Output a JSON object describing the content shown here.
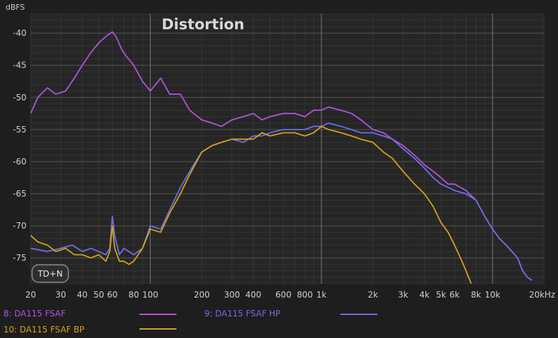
{
  "chart_data": {
    "type": "line",
    "title": "Distortion",
    "ylabel": "dBFS",
    "xunit": "Hz",
    "xscale": "log",
    "xlim": [
      20,
      20000
    ],
    "ylim": [
      -79,
      -37
    ],
    "grid": true,
    "legend_position": "bottom",
    "xticks": [
      {
        "v": 20,
        "label": "20"
      },
      {
        "v": 30,
        "label": "30"
      },
      {
        "v": 40,
        "label": "40"
      },
      {
        "v": 50,
        "label": "50"
      },
      {
        "v": 60,
        "label": "60"
      },
      {
        "v": 80,
        "label": "80"
      },
      {
        "v": 100,
        "label": "100"
      },
      {
        "v": 200,
        "label": "200"
      },
      {
        "v": 300,
        "label": "300"
      },
      {
        "v": 400,
        "label": "400"
      },
      {
        "v": 600,
        "label": "600"
      },
      {
        "v": 800,
        "label": "800"
      },
      {
        "v": 1000,
        "label": "1k"
      },
      {
        "v": 2000,
        "label": "2k"
      },
      {
        "v": 3000,
        "label": "3k"
      },
      {
        "v": 4000,
        "label": "4k"
      },
      {
        "v": 5000,
        "label": "5k"
      },
      {
        "v": 6000,
        "label": "6k"
      },
      {
        "v": 8000,
        "label": "8k"
      },
      {
        "v": 10000,
        "label": "10k"
      },
      {
        "v": 20000,
        "label": "20kHz"
      }
    ],
    "yticks": [
      {
        "v": -40,
        "label": "-40"
      },
      {
        "v": -45,
        "label": "-45"
      },
      {
        "v": -50,
        "label": "-50"
      },
      {
        "v": -55,
        "label": "-55"
      },
      {
        "v": -60,
        "label": "-60"
      },
      {
        "v": -65,
        "label": "-65"
      },
      {
        "v": -70,
        "label": "-70"
      },
      {
        "v": -75,
        "label": "-75"
      }
    ],
    "series": [
      {
        "name": "8: DA115 FSAF",
        "color": "#b254e0",
        "x": [
          20,
          22,
          25,
          28,
          32,
          36,
          40,
          45,
          50,
          55,
          60,
          63,
          68,
          72,
          80,
          90,
          100,
          115,
          130,
          150,
          170,
          200,
          230,
          260,
          300,
          350,
          400,
          450,
          500,
          600,
          700,
          800,
          900,
          1000,
          1100,
          1300,
          1500,
          1700,
          2000,
          2300,
          2600,
          3000,
          3500,
          4000,
          4500,
          5000,
          5500,
          6000,
          7000,
          8000,
          9000,
          10000,
          11000,
          12000,
          13000,
          14000,
          15000,
          16000,
          17000
        ],
        "y": [
          -52.5,
          -50,
          -48.5,
          -49.5,
          -49,
          -47,
          -45,
          -43,
          -41.5,
          -40.5,
          -39.8,
          -40.5,
          -42.5,
          -43.5,
          -45,
          -47.5,
          -49,
          -47,
          -49.5,
          -49.5,
          -52,
          -53.5,
          -54,
          -54.5,
          -53.5,
          -53,
          -52.5,
          -53.5,
          -53,
          -52.5,
          -52.5,
          -53,
          -52,
          -52,
          -51.5,
          -52,
          -52.5,
          -53.5,
          -55,
          -55.5,
          -56.5,
          -57.5,
          -59,
          -60.5,
          -61.5,
          -62.5,
          -63.5,
          -63.5,
          -64.5,
          -66,
          -68.5,
          -70.5,
          -72,
          -73,
          -74,
          -75,
          -77,
          -78,
          -78.5
        ]
      },
      {
        "name": "9: DA115 FSAF HP",
        "color": "#6f6fe6",
        "x": [
          20,
          25,
          30,
          35,
          40,
          45,
          50,
          55,
          58,
          60,
          62,
          66,
          70,
          75,
          80,
          90,
          100,
          115,
          130,
          150,
          170,
          200,
          230,
          260,
          300,
          350,
          400,
          450,
          500,
          600,
          700,
          800,
          900,
          1000,
          1100,
          1300,
          1500,
          1700,
          2000,
          2300,
          2600,
          3000,
          3500,
          4000,
          4500,
          5000,
          5500,
          6000,
          7000,
          8000,
          9000,
          10000,
          11000,
          12000,
          13000,
          14000,
          15000,
          16000,
          17000
        ],
        "y": [
          -73.5,
          -74,
          -73.5,
          -73,
          -74,
          -73.5,
          -74,
          -74.5,
          -73.5,
          -68.5,
          -71.5,
          -74.5,
          -73.5,
          -74,
          -74.5,
          -73.5,
          -70,
          -70.5,
          -67.5,
          -64,
          -61.5,
          -58.5,
          -57.5,
          -57,
          -56.5,
          -57,
          -56,
          -56,
          -55.5,
          -55,
          -55,
          -55,
          -54.5,
          -54.5,
          -54,
          -54.5,
          -55,
          -55.5,
          -55.5,
          -56,
          -56.5,
          -58,
          -59.5,
          -61,
          -62.5,
          -63.5,
          -64,
          -64.5,
          -65,
          -66,
          -68.5,
          -70.5,
          -72,
          -73,
          -74,
          -75,
          -77,
          -78,
          -78.5
        ]
      },
      {
        "name": "10: DA115 FSAF BP",
        "color": "#d4a21c",
        "x": [
          20,
          22,
          25,
          28,
          32,
          36,
          40,
          45,
          50,
          55,
          58,
          60,
          62,
          66,
          70,
          75,
          80,
          90,
          100,
          115,
          130,
          150,
          170,
          200,
          230,
          260,
          300,
          350,
          400,
          450,
          500,
          600,
          700,
          800,
          900,
          1000,
          1100,
          1300,
          1500,
          1700,
          2000,
          2300,
          2600,
          3000,
          3500,
          4000,
          4500,
          5000,
          5500,
          6000,
          6500,
          7000,
          7500
        ],
        "y": [
          -71.5,
          -72.5,
          -73,
          -74,
          -73.5,
          -74.5,
          -74.5,
          -75,
          -74.5,
          -75.5,
          -74,
          -70,
          -73.5,
          -75.5,
          -75.5,
          -76,
          -75.5,
          -73.5,
          -70.5,
          -71,
          -68,
          -65,
          -62,
          -58.5,
          -57.5,
          -57,
          -56.5,
          -56.5,
          -56.5,
          -55.5,
          -56,
          -55.5,
          -55.5,
          -56,
          -55.5,
          -54.5,
          -55,
          -55.5,
          -56,
          -56.5,
          -57,
          -58.5,
          -59.5,
          -61.5,
          -63.5,
          -65,
          -67,
          -69.5,
          -71,
          -73,
          -75,
          -77,
          -79
        ]
      }
    ]
  },
  "legend": [
    {
      "label": "8: DA115 FSAF",
      "color": "#b254e0"
    },
    {
      "label": "9: DA115 FSAF HP",
      "color": "#6f6fe6"
    },
    {
      "label": "10: DA115 FSAF BP",
      "color": "#d4a21c"
    }
  ],
  "button": {
    "label": "TD+N"
  }
}
